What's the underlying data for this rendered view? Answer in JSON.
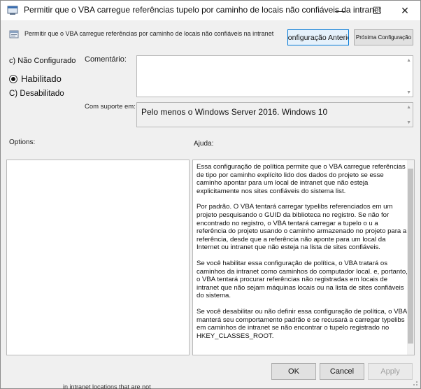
{
  "window": {
    "title": "Permitir que o VBA carregue referências tupelo por caminho de locais não confiáveis da intranet",
    "minimize_glyph": "—",
    "maximize_glyph": "☐",
    "close_glyph": "✕",
    "app_icon": "policy-editor-icon"
  },
  "header": {
    "setting_label": "Permitir que o VBA carregue referências por caminho de locais não confiáveis na intranet",
    "setting_icon": "policy-setting-icon",
    "prev_button": "Configuração Anterior",
    "next_button": "Próxima Configuração"
  },
  "state": {
    "not_configured": "c) Não Configurado",
    "enabled": "Habilitado",
    "disabled": "C) Desabilitado",
    "selected": "enabled"
  },
  "labels": {
    "comment": "Comentário:",
    "supported_on": "Com suporte em:",
    "options": "Options:",
    "help": "Ajuda:"
  },
  "supported_value": "Pelo menos o Windows Server 2016. Windows 10",
  "help_paragraphs": [
    "Essa configuração de política permite que o VBA carregue referências de tipo por caminho explícito lido dos dados do projeto se esse caminho apontar para um local de intranet que não esteja explicitamente nos sites confiáveis do sistema list.",
    "Por padrão. O VBA tentará carregar typelibs referenciados em um projeto pesquisando o GUID da biblioteca no registro. Se não for encontrado no registro, o VBA tentará carregar a tupelo o u a referência do projeto usando o caminho armazenado no projeto para a referência, desde que a referência não aponte para um local da Internet ou intranet que não esteja na lista de sites confiáveis.",
    "Se você habilitar essa configuração de política, o VBA tratará os caminhos da intranet como caminhos do computador local. e, portanto, o VBA tentará procurar referências não registradas em locais de intranet que não sejam máquinas locais ou na lista de sites confiáveis do sistema.",
    "Se você desabilitar ou não definir essa configuração de política, o VBA manterá seu comportamento padrão e se recusará a carregar typelibs em caminhos de intranet se não encontrar o tupelo registrado no HKEY_CLASSES_ROOT."
  ],
  "footer": {
    "ok": "OK",
    "cancel": "Cancel",
    "apply": "Apply"
  },
  "background_text": "in intranet locations that are not"
}
